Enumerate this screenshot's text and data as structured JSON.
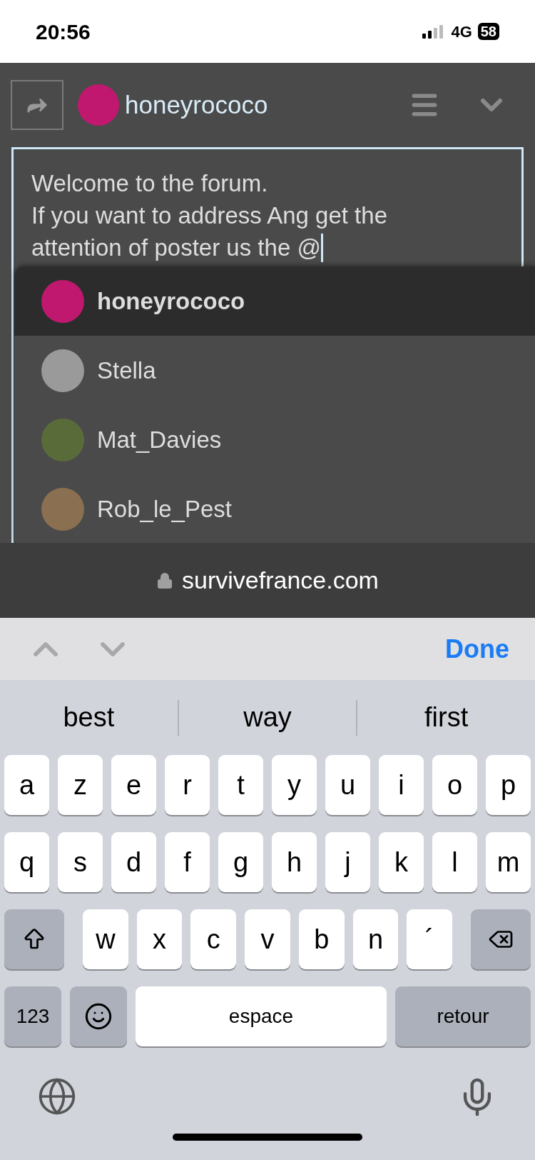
{
  "status_bar": {
    "time": "20:56",
    "network": "4G",
    "battery": "58"
  },
  "header": {
    "username": "honeyrococo"
  },
  "editor": {
    "lines": [
      "Welcome to the forum.",
      "If you want to address Ang get the",
      "attention of poster us the @"
    ]
  },
  "mentions": [
    {
      "name": "honeyrococo",
      "selected": true
    },
    {
      "name": "Stella",
      "selected": false
    },
    {
      "name": "Mat_Davies",
      "selected": false
    },
    {
      "name": "Rob_le_Pest",
      "selected": false
    }
  ],
  "address_bar": {
    "domain": "survivefrance.com"
  },
  "accessory_bar": {
    "done": "Done"
  },
  "suggestions": [
    "best",
    "way",
    "first"
  ],
  "keyboard": {
    "letter_row_1": [
      {
        "kind": "letter",
        "label": "a"
      },
      {
        "kind": "letter",
        "label": "z"
      },
      {
        "kind": "letter",
        "label": "e"
      },
      {
        "kind": "letter",
        "label": "r"
      },
      {
        "kind": "letter",
        "label": "t"
      },
      {
        "kind": "letter",
        "label": "y"
      },
      {
        "kind": "letter",
        "label": "u"
      },
      {
        "kind": "letter",
        "label": "i"
      },
      {
        "kind": "letter",
        "label": "o"
      },
      {
        "kind": "letter",
        "label": "p"
      }
    ],
    "letter_row_2": [
      {
        "kind": "letter",
        "label": "q"
      },
      {
        "kind": "letter",
        "label": "s"
      },
      {
        "kind": "letter",
        "label": "d"
      },
      {
        "kind": "letter",
        "label": "f"
      },
      {
        "kind": "letter",
        "label": "g"
      },
      {
        "kind": "letter",
        "label": "h"
      },
      {
        "kind": "letter",
        "label": "j"
      },
      {
        "kind": "letter",
        "label": "k"
      },
      {
        "kind": "letter",
        "label": "l"
      },
      {
        "kind": "letter",
        "label": "m"
      }
    ],
    "letter_row_3": [
      {
        "kind": "shift"
      },
      {
        "kind": "letter",
        "label": "w"
      },
      {
        "kind": "letter",
        "label": "x"
      },
      {
        "kind": "letter",
        "label": "c"
      },
      {
        "kind": "letter",
        "label": "v"
      },
      {
        "kind": "letter",
        "label": "b"
      },
      {
        "kind": "letter",
        "label": "n"
      },
      {
        "kind": "letter",
        "label": "´"
      },
      {
        "kind": "backspace"
      }
    ],
    "bottom_row": [
      {
        "kind": "numbers",
        "label": "123"
      },
      {
        "kind": "emoji"
      },
      {
        "kind": "space",
        "label": "espace"
      },
      {
        "kind": "return",
        "label": "retour"
      }
    ]
  }
}
